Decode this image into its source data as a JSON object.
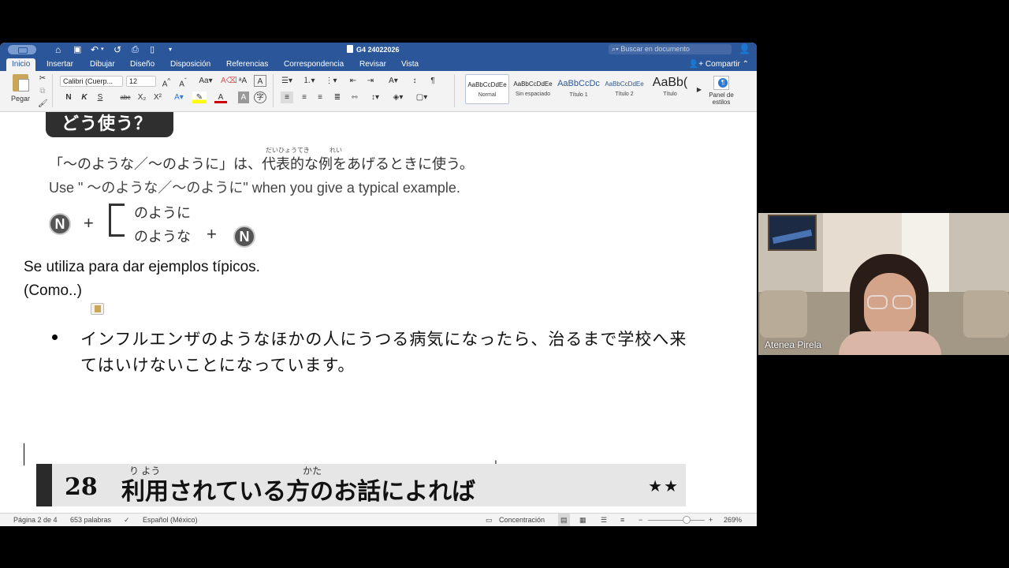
{
  "window": {
    "doc_title": "G4 24022026",
    "search_placeholder": "Buscar en documento",
    "share_label": "Compartir"
  },
  "tabs": [
    "Inicio",
    "Insertar",
    "Dibujar",
    "Diseño",
    "Disposición",
    "Referencias",
    "Correspondencia",
    "Revisar",
    "Vista"
  ],
  "ribbon": {
    "paste_label": "Pegar",
    "font_name": "Calibri (Cuerp...",
    "font_size": "12",
    "bold": "N",
    "italic": "K",
    "underline": "S",
    "strike": "abc",
    "sub": "X₂",
    "sup": "X²",
    "styles": [
      {
        "sample": "AaBbCcDdEe",
        "name": "Normal"
      },
      {
        "sample": "AaBbCcDdEe",
        "name": "Sin espaciado"
      },
      {
        "sample": "AaBbCcDc",
        "name": "Título 1"
      },
      {
        "sample": "AaBbCcDdEe",
        "name": "Título 2"
      },
      {
        "sample": "AaBb(",
        "name": "Título"
      }
    ],
    "panel_label_1": "Panel de",
    "panel_label_2": "estilos"
  },
  "document": {
    "banner_title": "どう使う？",
    "ruby_1": "だいひょうてき",
    "ruby_2": "れい",
    "jp_explanation": "「〜のような／〜のように」は、代表的な例をあげるときに使う。",
    "en_explanation": "Use \" 〜のような／〜のように\" when you give a typical example.",
    "n_symbol": "N",
    "plus": "+",
    "form_1": "のように",
    "form_2": "のような",
    "es_line_1": "Se utiliza para dar ejemplos típicos.",
    "es_line_2": "(Como..)",
    "example_sentence": "インフルエンザのようなほかの人にうつる病気になったら、治るまで学校へ来てはいけないことになっています。",
    "section_number": "28",
    "section_ruby_1": "り よう",
    "section_ruby_2": "かた",
    "section_title": "利用されている方のお話によれば",
    "section_stars": "★★"
  },
  "statusbar": {
    "page": "Página 2 de 4",
    "words": "653 palabras",
    "language": "Español (México)",
    "focus": "Concentración",
    "zoom": "269%"
  },
  "video": {
    "participant_name": "Atenea Pirela"
  }
}
